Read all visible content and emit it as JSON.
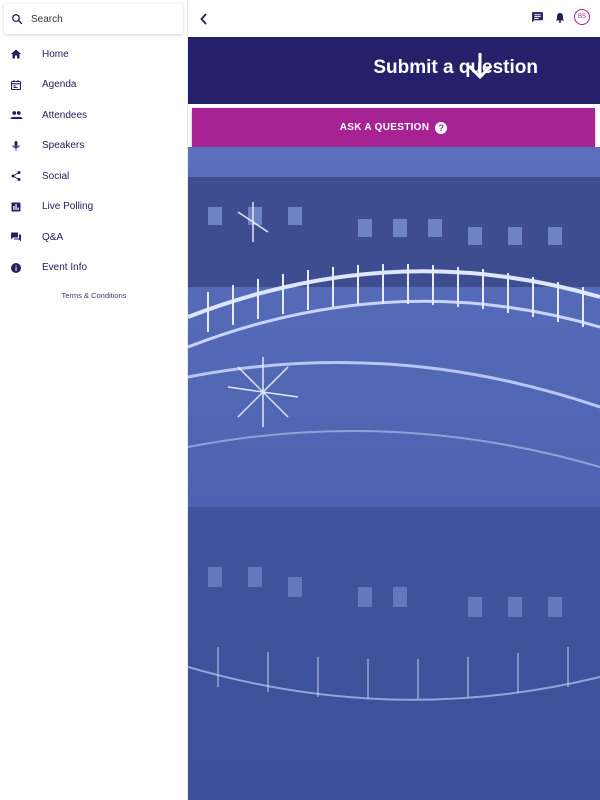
{
  "sidebar": {
    "search": {
      "placeholder": "Search",
      "icon": "search-icon"
    },
    "items": [
      {
        "label": "Home",
        "icon": "home-icon"
      },
      {
        "label": "Agenda",
        "icon": "calendar-icon"
      },
      {
        "label": "Attendees",
        "icon": "people-icon"
      },
      {
        "label": "Speakers",
        "icon": "microphone-icon"
      },
      {
        "label": "Social",
        "icon": "share-icon"
      },
      {
        "label": "Live Polling",
        "icon": "poll-icon"
      },
      {
        "label": "Q&A",
        "icon": "forum-icon"
      },
      {
        "label": "Event Info",
        "icon": "info-icon"
      }
    ],
    "terms": "Terms & Conditions"
  },
  "topbar": {
    "back_icon": "chevron-left-icon",
    "icons": [
      "chat-icon",
      "bell-icon"
    ],
    "avatar_initials": "BS"
  },
  "banner": {
    "title": "Submit a question",
    "arrow_icon": "arrow-down-icon"
  },
  "ask_button": {
    "label": "ASK A QUESTION",
    "icon": "help-circle-icon"
  },
  "background_image": {
    "icon": "bridge-photo"
  },
  "colors": {
    "primary": "#25206a",
    "accent": "#a72293",
    "photo_tint": "#4a5ea8"
  }
}
